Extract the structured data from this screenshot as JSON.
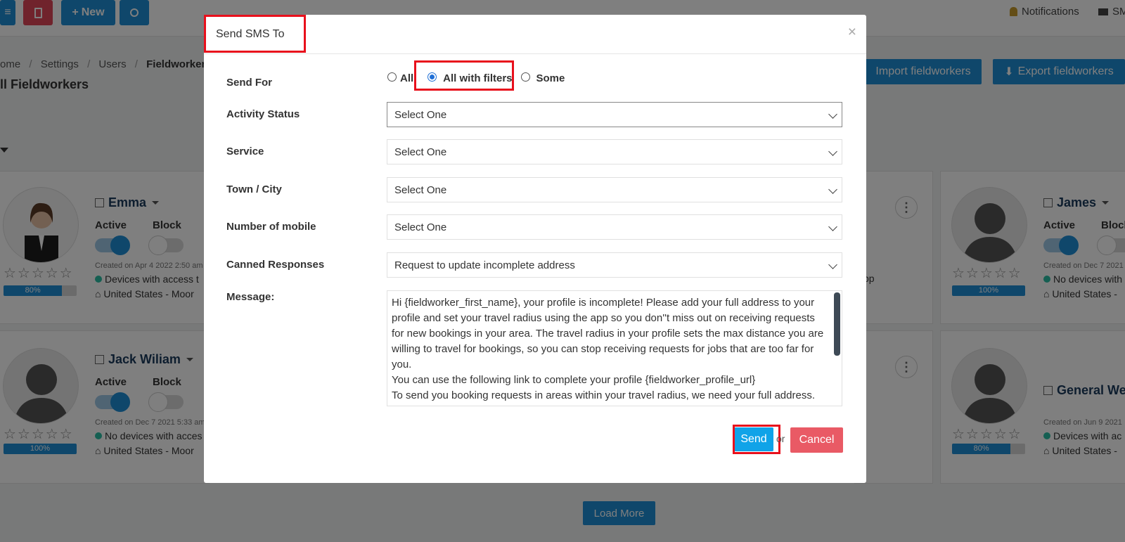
{
  "topbar": {
    "new_label": "New",
    "notifications_label": "Notifications",
    "sms_label": "SM"
  },
  "breadcrumb": [
    "ome",
    "Settings",
    "Users",
    "Fieldworkers"
  ],
  "page_title": "ll Fieldworkers",
  "header_buttons": {
    "import_label": "Import fieldworkers",
    "export_label": "Export fieldworkers"
  },
  "cards": [
    {
      "name": "Emma",
      "active_label": "Active",
      "block_label": "Block",
      "created": "Created on Apr 4 2022 2:50 am",
      "devices": "Devices with access t",
      "location": "United States - Moor",
      "progress": "80%",
      "progress_value": 80
    },
    {
      "name": "Jack Wiliam",
      "active_label": "Active",
      "block_label": "Block",
      "created": "Created on Dec 7 2021 5:33 am",
      "devices": "No devices with acces",
      "location": "United States - Moor",
      "progress": "100%",
      "progress_value": 100
    },
    {
      "name": "James",
      "active_label": "Active",
      "block_label": "Block",
      "created": "Created on Dec 7 2021",
      "devices": "No devices with",
      "location": "United States -",
      "progress": "100%",
      "progress_value": 100
    },
    {
      "name": "General We",
      "created": "Created on Jun 9 2021",
      "devices": "Devices with ac",
      "location": "United States -",
      "progress": "80%",
      "progress_value": 80
    }
  ],
  "bg_snippet": "pp",
  "load_more_label": "Load More",
  "modal": {
    "title": "Send SMS To",
    "close_glyph": "×",
    "send_for_label": "Send For",
    "send_for_options": [
      "All",
      "All with filters",
      "Some"
    ],
    "send_for_selected": "All with filters",
    "activity_status_label": "Activity Status",
    "activity_status_value": "Select One",
    "service_label": "Service",
    "service_value": "Select One",
    "town_label": "Town / City",
    "town_value": "Select One",
    "mobile_label": "Number of mobile",
    "mobile_value": "Select One",
    "canned_label": "Canned Responses",
    "canned_value": "Request to update incomplete address",
    "message_label": "Message:",
    "message_lines": [
      "Hi {fieldworker_first_name}, your profile is incomplete! Please add your full address to your profile and set your travel radius using the app so you don''t miss out on receiving requests for new bookings in your area. The travel radius in your profile sets the max distance you are willing to travel for bookings, so you can stop receiving requests for jobs that are too far for you.",
      "You can use the following link to complete your profile {fieldworker_profile_url}",
      "To send you booking requests in areas within your travel radius, we need your full address."
    ],
    "send_label": "Send",
    "or_label": "or",
    "cancel_label": "Cancel"
  }
}
